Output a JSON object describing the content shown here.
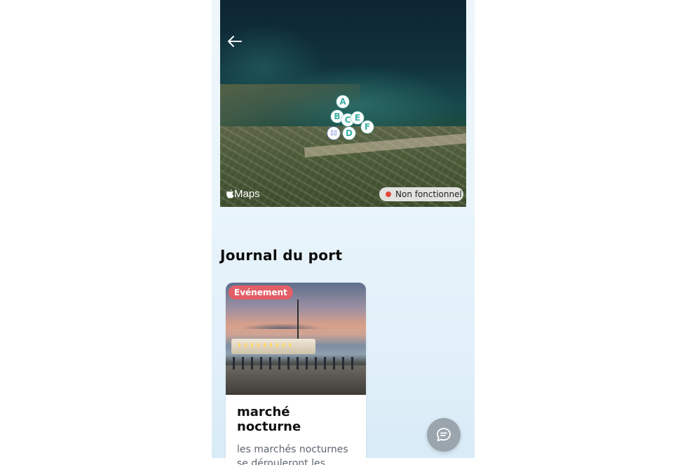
{
  "map": {
    "markers": [
      "A",
      "B",
      "C",
      "E",
      "D",
      "F"
    ],
    "position_marker": "▯▯",
    "attribution": "Maps",
    "status": {
      "label": "Non fonctionnel",
      "color": "#e24b3b"
    },
    "icons": {
      "back": "arrow-left-icon",
      "apple": "apple-icon"
    }
  },
  "journal": {
    "title": "Journal du port",
    "cards": [
      {
        "badge": "Evénement",
        "title": "marché nocturne",
        "description": "les marchés nocturnes se dérouleront les"
      }
    ]
  },
  "chat": {
    "icon": "chat-bubble-icon"
  },
  "colors": {
    "accent": "#3ab1a5",
    "badge": "#e35f67",
    "chat_button": "#9aa5ad"
  }
}
